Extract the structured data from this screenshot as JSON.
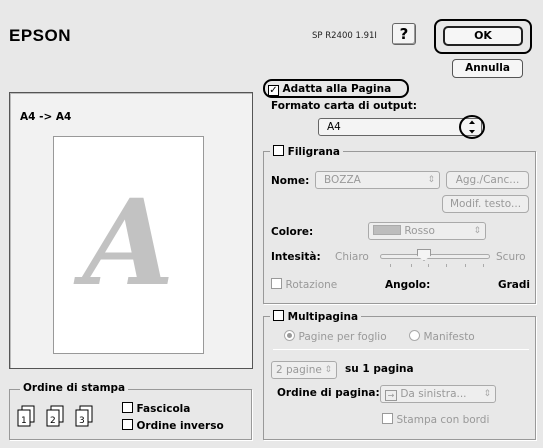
{
  "header": {
    "brand": "EPSON",
    "version": "SP R2400 1.91I",
    "help_label": "?",
    "ok_label": "OK",
    "cancel_label": "Annulla"
  },
  "preview": {
    "label": "A4 -> A4",
    "paper_letter": "A"
  },
  "fit_page": {
    "checkbox_label": "Adatta alla Pagina",
    "checked": true,
    "output_label": "Formato carta di output:",
    "output_value": "A4"
  },
  "watermark": {
    "title": "Filigrana",
    "name_label": "Nome:",
    "name_value": "BOZZA",
    "add_delete_label": "Agg./Canc...",
    "modify_text_label": "Modif. testo...",
    "color_label": "Colore:",
    "color_value": "Rosso",
    "intensity_label": "Intesità:",
    "intensity_light": "Chiaro",
    "intensity_dark": "Scuro",
    "intensity_level": 0.4,
    "rotation_label": "Rotazione",
    "angle_label": "Angolo:",
    "angle_unit": "Gradi"
  },
  "multipage": {
    "title": "Multipagina",
    "radio_pages_per_sheet": "Pagine per foglio",
    "radio_poster": "Manifesto",
    "pages_value": "2 pagine",
    "pages_suffix": "su 1 pagina",
    "order_label": "Ordine di pagina:",
    "order_value": "Da sinistra...",
    "print_borders_label": "Stampa con bordi"
  },
  "print_order": {
    "title": "Ordine di stampa",
    "collate_label": "Fascicola",
    "reverse_label": "Ordine inverso",
    "icon_numbers": [
      "1",
      "2",
      "3"
    ]
  }
}
